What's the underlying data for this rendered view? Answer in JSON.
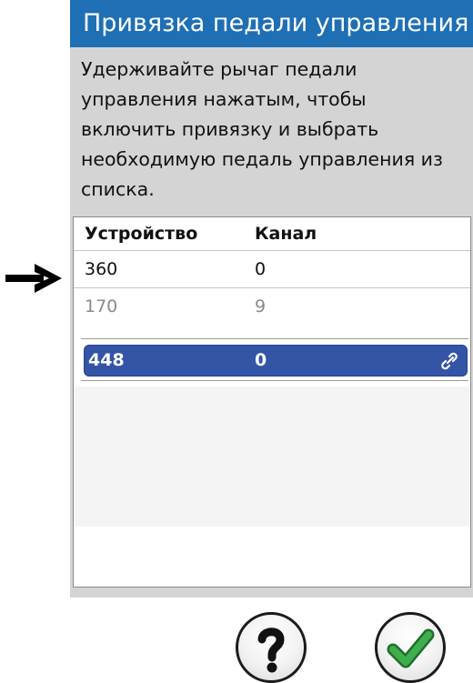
{
  "header": {
    "title": "Привязка педали управления"
  },
  "instructions": {
    "lines": [
      "Удерживайте рычаг педали",
      "управления нажатым, чтобы",
      "включить привязку и выбрать",
      "необходимую педаль управления из",
      "списка."
    ]
  },
  "list": {
    "columns": {
      "device": "Устройство",
      "channel": "Канал"
    },
    "rows": [
      {
        "device": "360",
        "channel": "0",
        "state": "normal"
      },
      {
        "device": "170",
        "channel": "9",
        "state": "dimmed"
      },
      {
        "device": "448",
        "channel": "0",
        "state": "selected",
        "icon": "link-icon"
      }
    ]
  },
  "pointer": {
    "icon": "right-arrow-icon"
  },
  "buttons": {
    "help": {
      "icon": "question-mark-icon"
    },
    "confirm": {
      "icon": "check-mark-icon",
      "color": "#2e8b3a"
    }
  },
  "colors": {
    "header_bg": "#1f6fb4",
    "panel_bg": "#d4d4d4",
    "selected_row_bg": "#3454a6"
  }
}
